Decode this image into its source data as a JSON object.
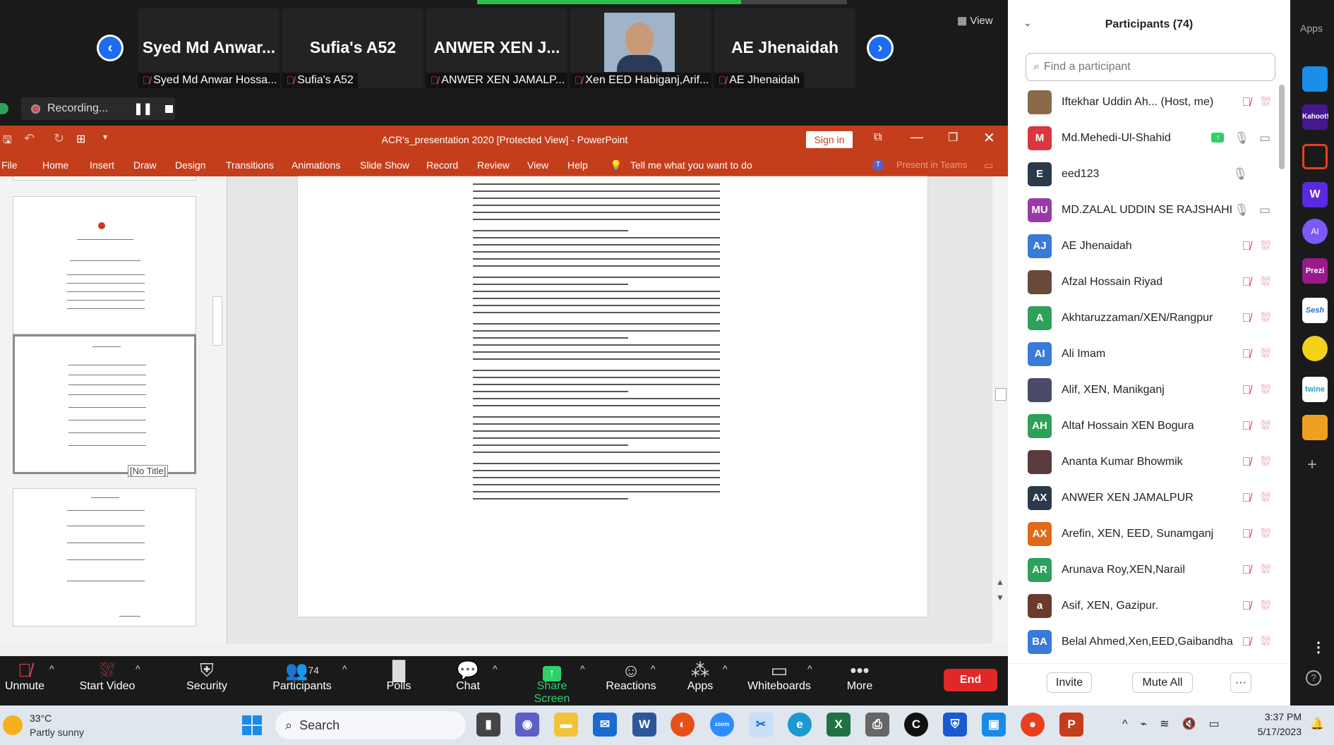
{
  "strip": {
    "view_label": "View",
    "tiles": [
      {
        "name": "Syed Md Anwar...",
        "label": "Syed Md Anwar Hossa..."
      },
      {
        "name": "Sufia's A52",
        "label": "Sufia's A52"
      },
      {
        "name": "ANWER  XEN  J...",
        "label": "ANWER  XEN  JAMALP..."
      },
      {
        "name": "",
        "label": "Xen EED Habiganj,Arif..."
      },
      {
        "name": "AE Jhenaidah",
        "label": "AE Jhenaidah"
      }
    ],
    "recording": "Recording..."
  },
  "ppt": {
    "title": "ACR's_presentation 2020 [Protected View]  -  PowerPoint",
    "sign_in": "Sign in",
    "tabs": [
      "File",
      "Home",
      "Insert",
      "Draw",
      "Design",
      "Transitions",
      "Animations",
      "Slide Show",
      "Record",
      "Review",
      "View",
      "Help"
    ],
    "tell_me": "Tell me what you want to do",
    "present_teams": "Present in Teams",
    "tooltip": "[No Title]"
  },
  "panel": {
    "title": "Participants (74)",
    "find_placeholder": "Find a participant",
    "invite": "Invite",
    "mute_all": "Mute All",
    "more": "···",
    "participants": [
      {
        "initials": "",
        "name": "Iftekhar Uddin Ah... (Host, me)",
        "color": "#8a6a4a",
        "photo": true,
        "mic": "muted",
        "video": "off"
      },
      {
        "initials": "M",
        "name": "Md.Mehedi-Ul-Shahid",
        "color": "#d9363e",
        "photo": false,
        "mic": "on",
        "video": "on"
      },
      {
        "initials": "E",
        "name": "eed123",
        "color": "#2a3a4a",
        "photo": false,
        "mic": "on",
        "video": "none"
      },
      {
        "initials": "MU",
        "name": "MD.ZALAL UDDIN SE RAJSHAHI ...",
        "color": "#9a3aa8",
        "photo": false,
        "mic": "on",
        "video": "on"
      },
      {
        "initials": "AJ",
        "name": "AE Jhenaidah",
        "color": "#3a7ad9",
        "photo": false,
        "mic": "muted",
        "video": "off"
      },
      {
        "initials": "",
        "name": "Afzal Hossain Riyad",
        "color": "#6a4a3a",
        "photo": true,
        "mic": "muted",
        "video": "off"
      },
      {
        "initials": "A",
        "name": "Akhtaruzzaman/XEN/Rangpur",
        "color": "#2ea05a",
        "photo": false,
        "mic": "muted",
        "video": "off"
      },
      {
        "initials": "AI",
        "name": "Ali Imam",
        "color": "#3a7ad9",
        "photo": false,
        "mic": "muted",
        "video": "off"
      },
      {
        "initials": "",
        "name": "Alif, XEN, Manikganj",
        "color": "#4a4a6a",
        "photo": true,
        "mic": "muted",
        "video": "off"
      },
      {
        "initials": "AH",
        "name": "Altaf Hossain XEN Bogura",
        "color": "#2ea05a",
        "photo": false,
        "mic": "muted",
        "video": "off"
      },
      {
        "initials": "",
        "name": "Ananta Kumar Bhowmik",
        "color": "#5a3a3a",
        "photo": true,
        "mic": "muted",
        "video": "off"
      },
      {
        "initials": "AX",
        "name": "ANWER  XEN  JAMALPUR",
        "color": "#2a3a4a",
        "photo": false,
        "mic": "muted",
        "video": "off"
      },
      {
        "initials": "AX",
        "name": "Arefin, XEN, EED, Sunamganj",
        "color": "#e06a1a",
        "photo": false,
        "mic": "muted",
        "video": "off"
      },
      {
        "initials": "AR",
        "name": "Arunava Roy,XEN,Narail",
        "color": "#2ea05a",
        "photo": false,
        "mic": "muted",
        "video": "off"
      },
      {
        "initials": "a",
        "name": "Asif, XEN, Gazipur.",
        "color": "#6a3a2a",
        "photo": false,
        "mic": "muted",
        "video": "off"
      },
      {
        "initials": "BA",
        "name": "Belal Ahmed,Xen,EED,Gaibandha",
        "color": "#3a7ad9",
        "photo": false,
        "mic": "muted",
        "video": "off"
      }
    ]
  },
  "apps_bar": {
    "label": "Apps",
    "items": [
      "Kahoot!",
      "Prezi",
      "Sesh",
      "twine"
    ]
  },
  "toolbar": {
    "unmute": "Unmute",
    "start_video": "Start Video",
    "security": "Security",
    "participants": "Participants",
    "participants_count": "74",
    "polls": "Polls",
    "chat": "Chat",
    "share_screen": "Share Screen",
    "reactions": "Reactions",
    "apps": "Apps",
    "whiteboards": "Whiteboards",
    "more": "More",
    "end": "End"
  },
  "taskbar": {
    "temp": "33°C",
    "weather": "Partly sunny",
    "search": "Search",
    "time": "3:37 PM",
    "date": "5/17/2023"
  }
}
